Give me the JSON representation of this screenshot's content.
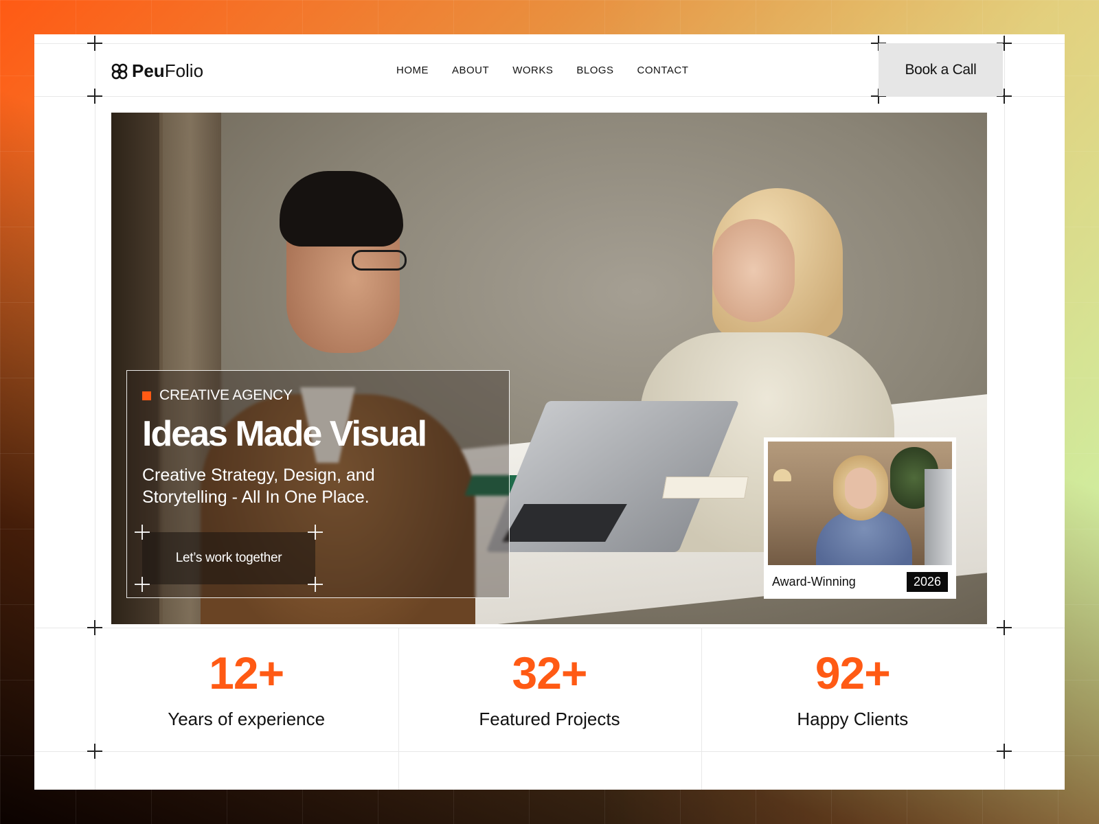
{
  "brand": {
    "logo_bold": "Peu",
    "logo_light": "Folio"
  },
  "nav": {
    "items": [
      "HOME",
      "ABOUT",
      "WORKS",
      "BLOGS",
      "CONTACT"
    ]
  },
  "header": {
    "cta_label": "Book a Call"
  },
  "hero": {
    "tag": "CREATIVE AGENCY",
    "title": "Ideas Made Visual",
    "subtitle": "Creative Strategy, Design, and Storytelling - All In One Place.",
    "cta_label": "Let’s work together"
  },
  "award_card": {
    "label": "Award-Winning",
    "year": "2026"
  },
  "stats": [
    {
      "value": "12+",
      "label": "Years of experience"
    },
    {
      "value": "32+",
      "label": "Featured Projects"
    },
    {
      "value": "92+",
      "label": "Happy Clients"
    }
  ],
  "colors": {
    "accent": "#ff5a14",
    "text": "#111111",
    "button_bg": "#e6e6e6",
    "card_bg": "#ffffff"
  },
  "icons": {
    "logo": "clover-logo-icon",
    "tag_marker": "square-marker-icon"
  }
}
